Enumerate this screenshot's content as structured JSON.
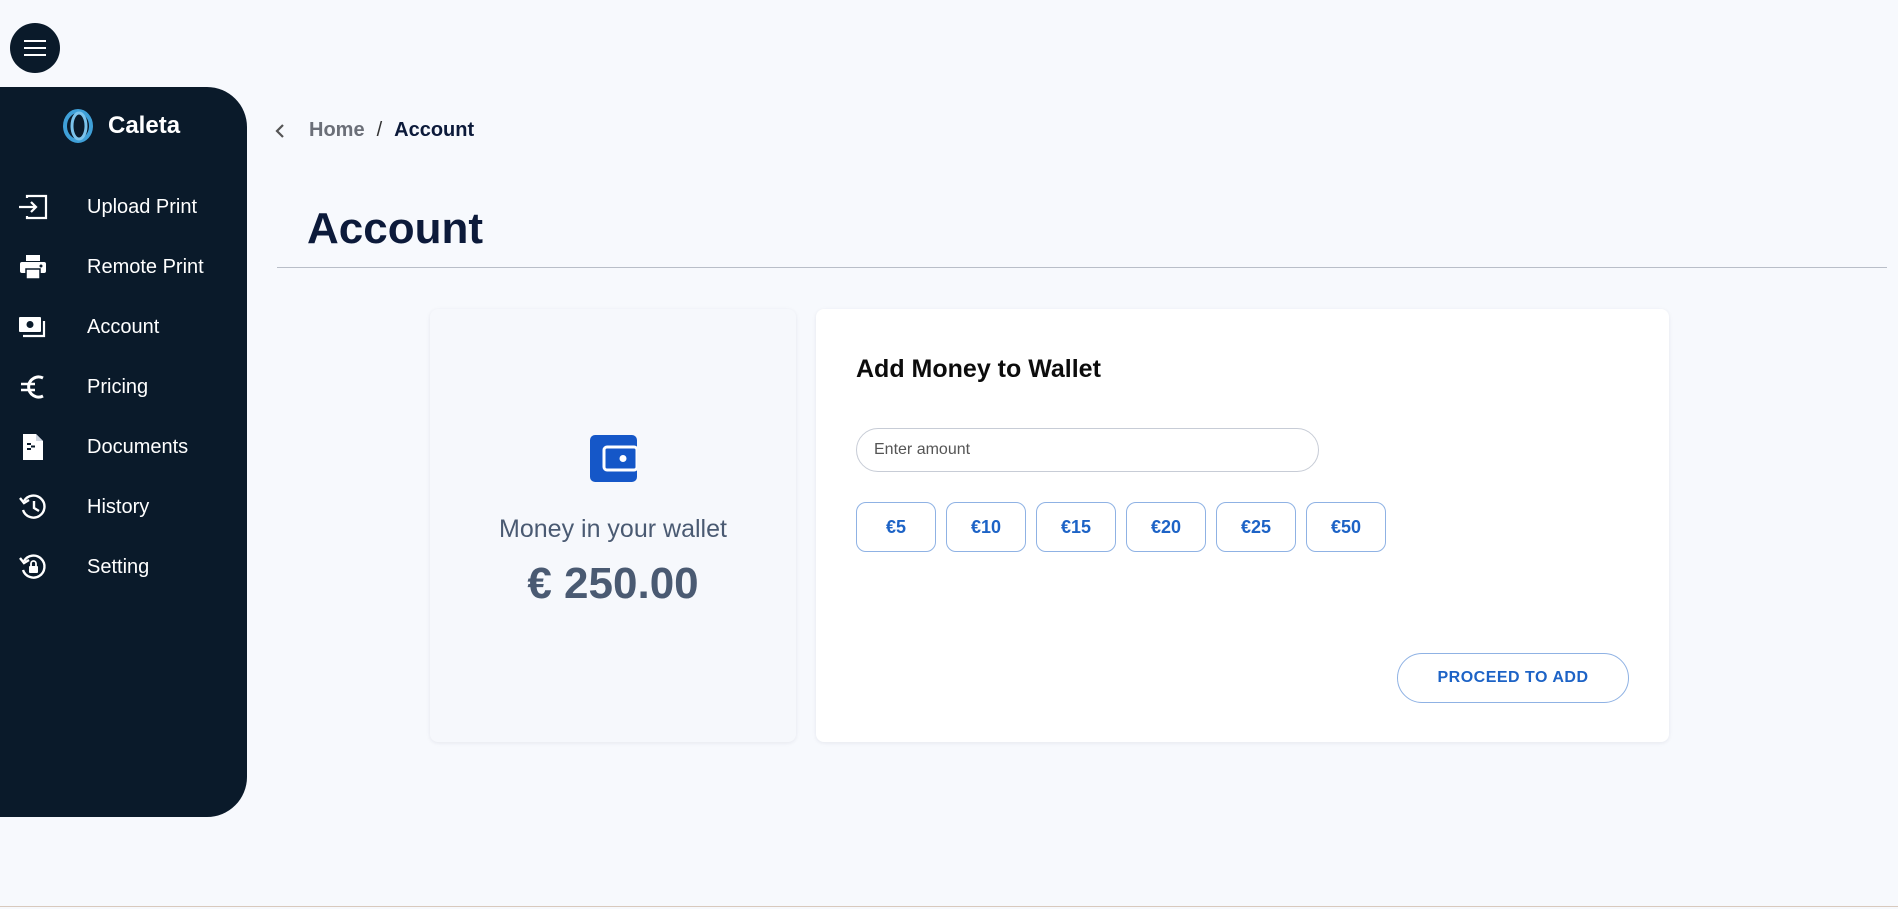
{
  "app": {
    "brand_name": "Caleta",
    "brand_icon": "caleta-logo",
    "menu_icon": "hamburger-icon"
  },
  "sidebar": {
    "items": [
      {
        "label": "Upload Print",
        "icon": "upload-print-icon"
      },
      {
        "label": "Remote Print",
        "icon": "printer-icon"
      },
      {
        "label": "Account",
        "icon": "account-wallet-icon"
      },
      {
        "label": "Pricing",
        "icon": "euro-icon"
      },
      {
        "label": "Documents",
        "icon": "document-icon"
      },
      {
        "label": "History",
        "icon": "history-icon"
      },
      {
        "label": "Setting",
        "icon": "settings-icon"
      }
    ]
  },
  "breadcrumb": {
    "home": "Home",
    "separator": "/",
    "current": "Account"
  },
  "page": {
    "title": "Account"
  },
  "wallet": {
    "label": "Money in your wallet",
    "amount": "€ 250.00",
    "icon": "wallet-icon"
  },
  "add_money": {
    "title": "Add Money to Wallet",
    "input_placeholder": "Enter amount",
    "input_value": "",
    "presets": [
      "€5",
      "€10",
      "€15",
      "€20",
      "€25",
      "€50"
    ],
    "proceed_label": "PROCEED TO ADD"
  },
  "colors": {
    "sidebar_bg": "#0a1a2a",
    "page_bg": "#f7f9fd",
    "accent_blue": "#1d63c6",
    "wallet_icon": "#1557c8"
  }
}
